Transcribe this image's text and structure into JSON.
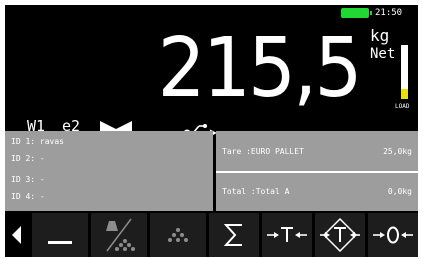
{
  "status": {
    "time": "21:50",
    "battery_color": "#22d633",
    "battery_icon": "battery-icon"
  },
  "weight": {
    "value": "215,5",
    "unit": "kg",
    "mode": "Net",
    "load_label": "LOAD",
    "load_level_fraction": 0.18,
    "load_bar_color": "#e6df1e"
  },
  "indicators": {
    "weighing_channel": "W1",
    "range": "e2",
    "zero_icon": "center-of-zero-icon",
    "usb_icon": "usb-icon"
  },
  "ids": [
    {
      "text": "ID 1: ravas"
    },
    {
      "text": "ID 2: -"
    },
    {
      "text": "ID 3: -"
    },
    {
      "text": "ID 4: -"
    }
  ],
  "tare": {
    "label": "Tare :EURO PALLET",
    "value": "25,0kg"
  },
  "total": {
    "label": "Total :Total A",
    "value": "0,0kg"
  },
  "function_keys": [
    {
      "icon": "left-arrow-icon"
    },
    {
      "icon": "underscore-icon"
    },
    {
      "icon": "weight-to-pieces-icon"
    },
    {
      "icon": "count-pieces-icon"
    },
    {
      "icon": "sum-icon",
      "glyph": "∑"
    },
    {
      "icon": "tare-icon",
      "glyph": "→T←"
    },
    {
      "icon": "preset-tare-icon",
      "glyph": "→T←"
    },
    {
      "icon": "zero-icon",
      "glyph": "→0←"
    }
  ],
  "colors": {
    "screen_bg": "#000000",
    "panel_bg": "#9d9d9d",
    "key_bg": "#1d1d1d",
    "text": "#ffffff"
  }
}
